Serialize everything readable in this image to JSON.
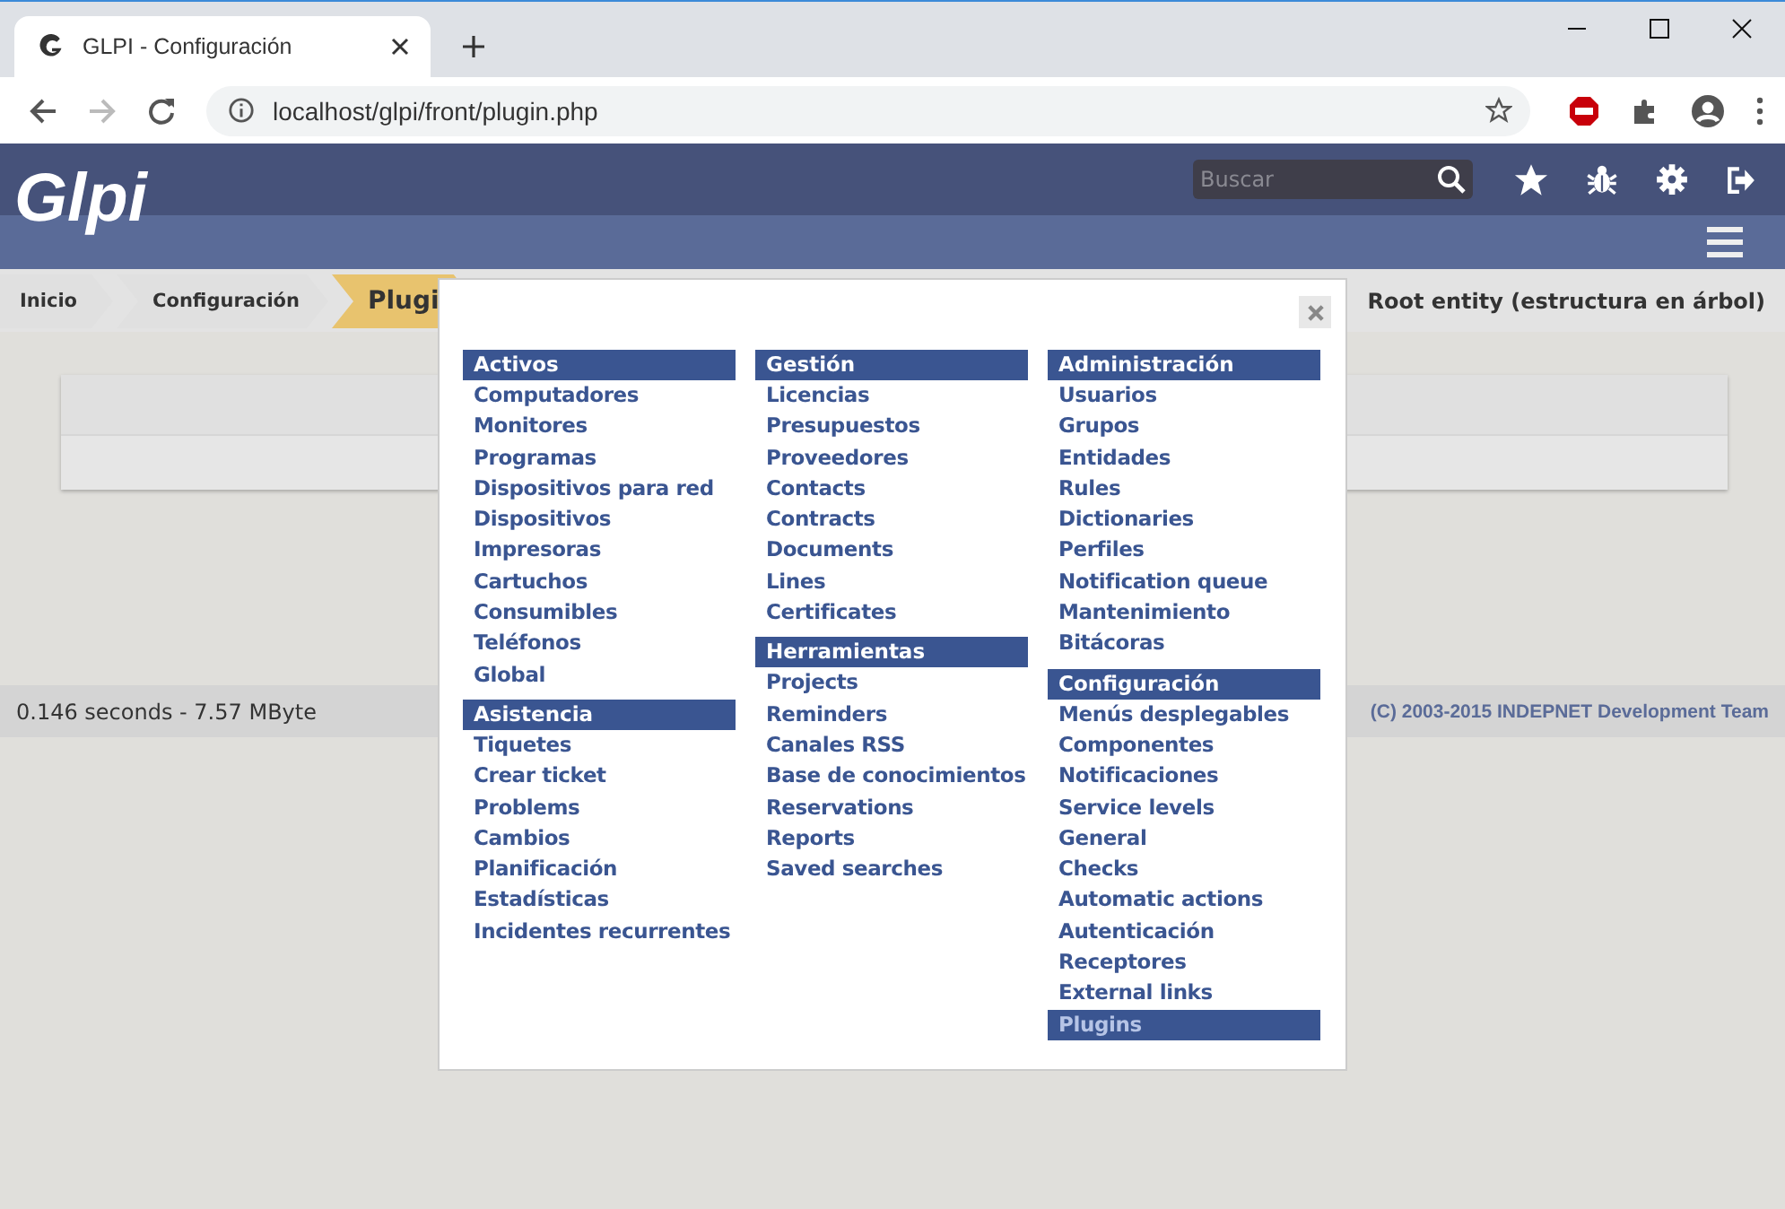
{
  "browser": {
    "tab_title": "GLPI - Configuración",
    "url": "localhost/glpi/front/plugin.php"
  },
  "header": {
    "logo": "Glpi",
    "search": {
      "placeholder": "Buscar"
    }
  },
  "breadcrumb": [
    {
      "label": "Inicio",
      "selected": false
    },
    {
      "label": "Configuración",
      "selected": false
    },
    {
      "label": "Plugi",
      "selected": true
    }
  ],
  "entity": "Root entity (estructura en árbol)",
  "footer": {
    "timing": "0.146 seconds - 7.57 MByte",
    "copyright": "(C) 2003-2015 INDEPNET Development Team"
  },
  "menu": {
    "columns": [
      [
        {
          "title": "Activos",
          "items": [
            {
              "label": "Computadores",
              "selected": false
            },
            {
              "label": "Monitores",
              "selected": false
            },
            {
              "label": "Programas",
              "selected": false
            },
            {
              "label": "Dispositivos para red",
              "selected": false
            },
            {
              "label": "Dispositivos",
              "selected": false
            },
            {
              "label": "Impresoras",
              "selected": false
            },
            {
              "label": "Cartuchos",
              "selected": false
            },
            {
              "label": "Consumibles",
              "selected": false
            },
            {
              "label": "Teléfonos",
              "selected": false
            },
            {
              "label": "Global",
              "selected": false
            }
          ]
        },
        {
          "title": "Asistencia",
          "items": [
            {
              "label": "Tiquetes",
              "selected": false
            },
            {
              "label": "Crear ticket",
              "selected": false
            },
            {
              "label": "Problems",
              "selected": false
            },
            {
              "label": "Cambios",
              "selected": false
            },
            {
              "label": "Planificación",
              "selected": false
            },
            {
              "label": "Estadísticas",
              "selected": false
            },
            {
              "label": "Incidentes recurrentes",
              "selected": false
            }
          ]
        }
      ],
      [
        {
          "title": "Gestión",
          "items": [
            {
              "label": "Licencias",
              "selected": false
            },
            {
              "label": "Presupuestos",
              "selected": false
            },
            {
              "label": "Proveedores",
              "selected": false
            },
            {
              "label": "Contacts",
              "selected": false
            },
            {
              "label": "Contracts",
              "selected": false
            },
            {
              "label": "Documents",
              "selected": false
            },
            {
              "label": "Lines",
              "selected": false
            },
            {
              "label": "Certificates",
              "selected": false
            }
          ]
        },
        {
          "title": "Herramientas",
          "items": [
            {
              "label": "Projects",
              "selected": false
            },
            {
              "label": "Reminders",
              "selected": false
            },
            {
              "label": "Canales RSS",
              "selected": false
            },
            {
              "label": "Base de conocimientos",
              "selected": false
            },
            {
              "label": "Reservations",
              "selected": false
            },
            {
              "label": "Reports",
              "selected": false
            },
            {
              "label": "Saved searches",
              "selected": false
            }
          ]
        }
      ],
      [
        {
          "title": "Administración",
          "items": [
            {
              "label": "Usuarios",
              "selected": false
            },
            {
              "label": "Grupos",
              "selected": false
            },
            {
              "label": "Entidades",
              "selected": false
            },
            {
              "label": "Rules",
              "selected": false
            },
            {
              "label": "Dictionaries",
              "selected": false
            },
            {
              "label": "Perfiles",
              "selected": false
            },
            {
              "label": "Notification queue",
              "selected": false
            },
            {
              "label": "Mantenimiento",
              "selected": false
            },
            {
              "label": "Bitácoras",
              "selected": false
            }
          ]
        },
        {
          "title": "Configuración",
          "items": [
            {
              "label": "Menús desplegables",
              "selected": false
            },
            {
              "label": "Componentes",
              "selected": false
            },
            {
              "label": "Notificaciones",
              "selected": false
            },
            {
              "label": "Service levels",
              "selected": false
            },
            {
              "label": "General",
              "selected": false
            },
            {
              "label": "Checks",
              "selected": false
            },
            {
              "label": "Automatic actions",
              "selected": false
            },
            {
              "label": "Autenticación",
              "selected": false
            },
            {
              "label": "Receptores",
              "selected": false
            },
            {
              "label": "External links",
              "selected": false
            },
            {
              "label": "Plugins",
              "selected": true
            }
          ]
        }
      ]
    ]
  }
}
